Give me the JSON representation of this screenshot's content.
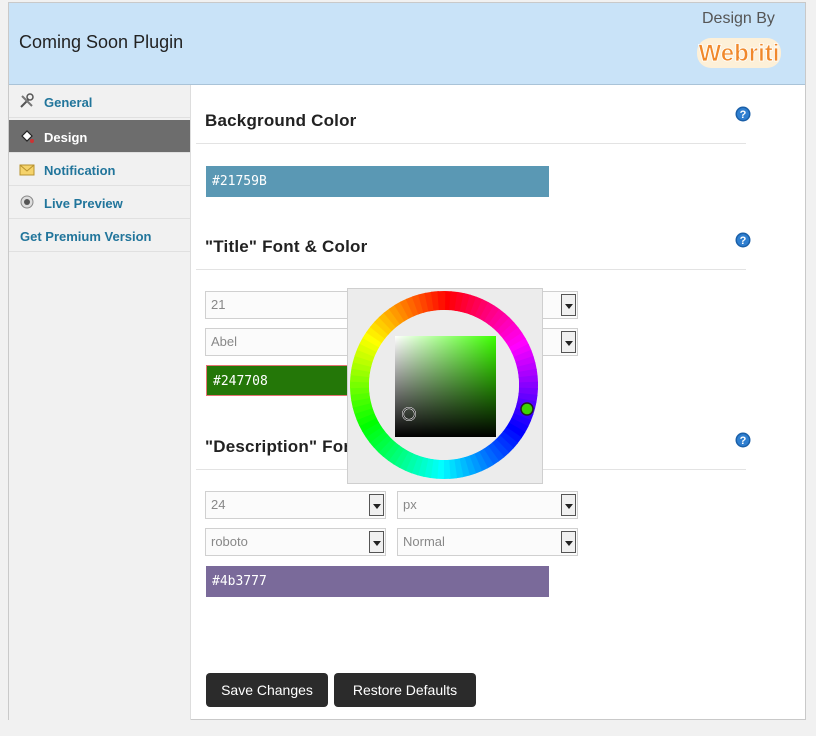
{
  "header": {
    "title": "Coming Soon Plugin",
    "design_by": "Design By",
    "logo_text": "Webriti"
  },
  "sidebar": {
    "items": [
      {
        "label": "General",
        "icon": "tools-icon"
      },
      {
        "label": "Design",
        "icon": "paint-bucket-icon",
        "active": true
      },
      {
        "label": "Notification",
        "icon": "envelope-icon"
      },
      {
        "label": "Live Preview",
        "icon": "preview-icon"
      },
      {
        "label": "Get Premium Version"
      }
    ]
  },
  "sections": {
    "background": {
      "title": "Background Color",
      "color_value": "#21759B",
      "color": "#5a98b4"
    },
    "title_font": {
      "title": "\"Title\" Font & Color",
      "size": "21",
      "font": "Abel",
      "color_value": "#247708",
      "color": "#247708"
    },
    "description_font": {
      "title": "\"Description\" Font",
      "size": "24",
      "unit": "px",
      "font": "roboto",
      "weight": "Normal",
      "color_value": "#4b3777",
      "color": "#7a6a9a"
    }
  },
  "buttons": {
    "save": "Save Changes",
    "restore": "Restore Defaults"
  }
}
